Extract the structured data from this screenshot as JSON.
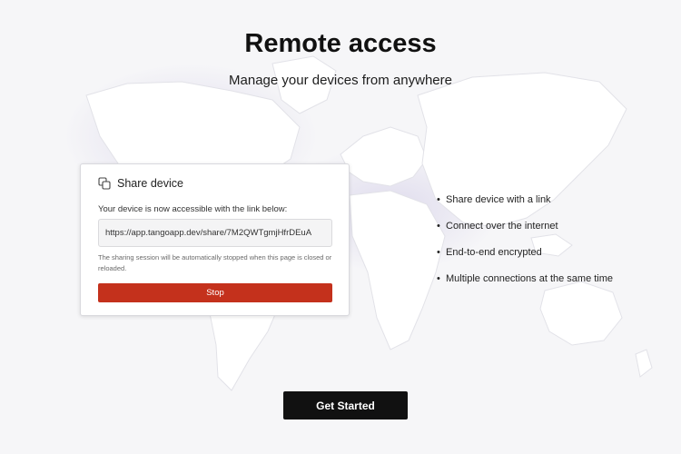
{
  "header": {
    "title": "Remote access",
    "subtitle": "Manage your devices from anywhere"
  },
  "share_card": {
    "heading": "Share device",
    "icon": "copy-icon",
    "description": "Your device is now accessible with the link below:",
    "link": "https://app.tangoapp.dev/share/7M2QWTgmjHfrDEuA",
    "note": "The sharing session will be automatically stopped when this page is closed or reloaded.",
    "stop_label": "Stop",
    "stop_color": "#c4311c"
  },
  "features": [
    "Share device with a link",
    "Connect over the internet",
    "End-to-end encrypted",
    "Multiple connections at the same time"
  ],
  "cta": {
    "label": "Get Started"
  }
}
